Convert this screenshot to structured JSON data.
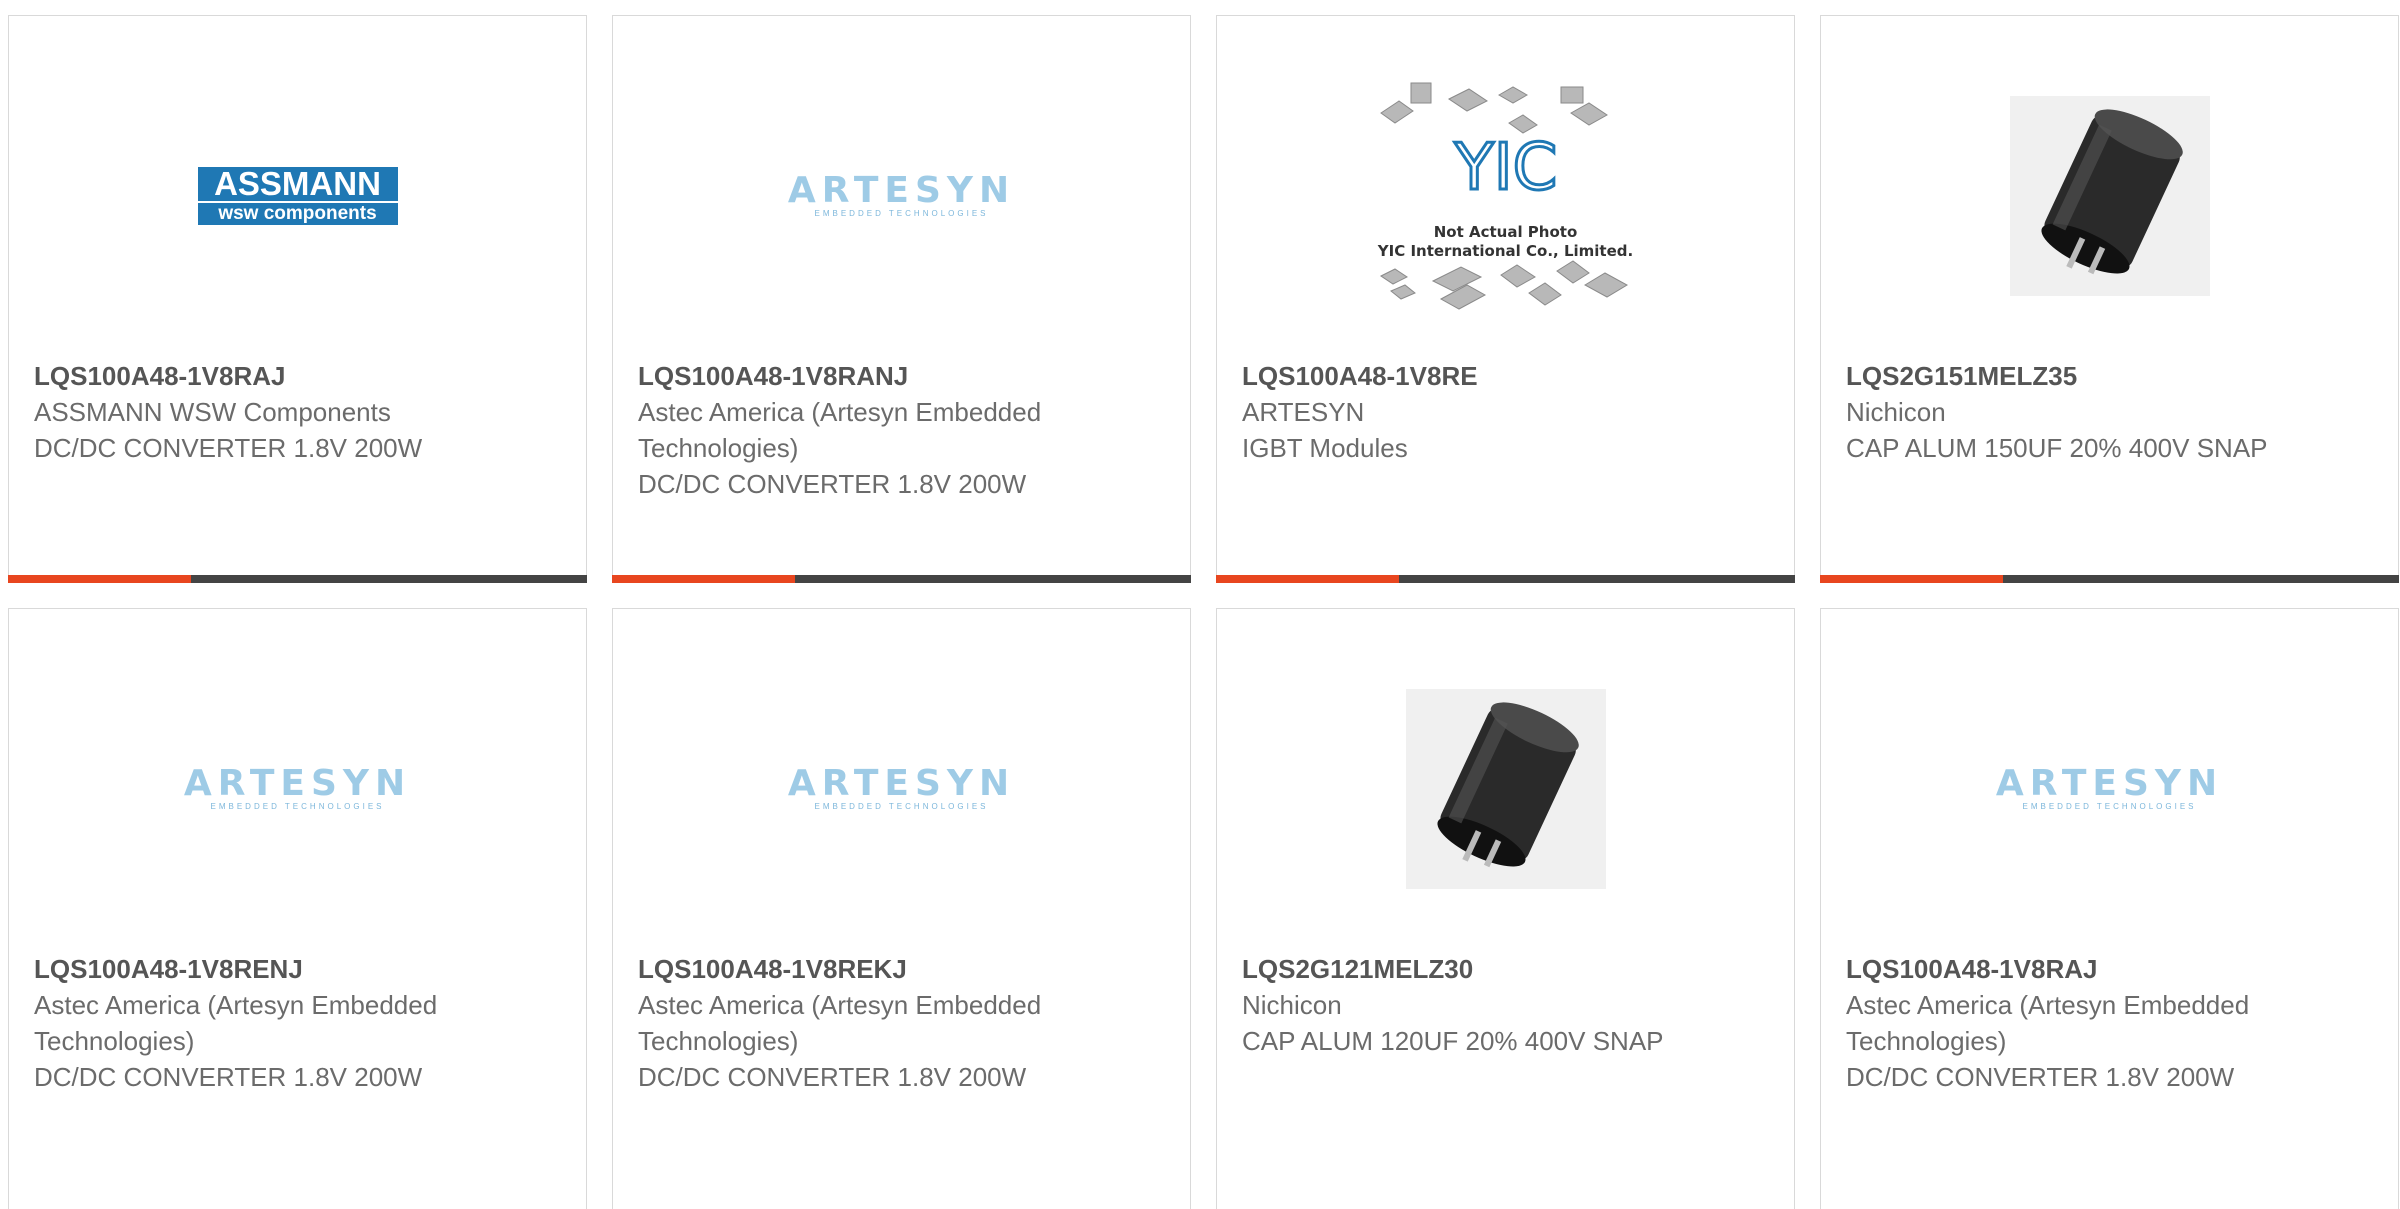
{
  "cards": [
    {
      "part_number": "LQS100A48-1V8RAJ",
      "manufacturer": "ASSMANN WSW Components",
      "description": "DC/DC CONVERTER 1.8V 200W",
      "image": "assmann-logo",
      "logo_text": "ASSMANN",
      "logo_subtext": "wsw components"
    },
    {
      "part_number": "LQS100A48-1V8RANJ",
      "manufacturer": "Astec America (Artesyn Embedded Technologies)",
      "description": "DC/DC CONVERTER 1.8V 200W",
      "image": "artesyn-logo",
      "logo_text": "ARTESYN",
      "logo_subtext": "EMBEDDED TECHNOLOGIES"
    },
    {
      "part_number": "LQS100A48-1V8RE",
      "manufacturer": "ARTESYN",
      "description": "IGBT Modules",
      "image": "yic-placeholder",
      "logo_text": "YIC",
      "caption_line1": "Not Actual Photo",
      "caption_line2": "YIC International Co., Limited."
    },
    {
      "part_number": "LQS2G151MELZ35",
      "manufacturer": "Nichicon",
      "description": "CAP ALUM 150UF 20% 400V SNAP",
      "image": "capacitor-photo"
    },
    {
      "part_number": "LQS100A48-1V8RENJ",
      "manufacturer": "Astec America (Artesyn Embedded Technologies)",
      "description": "DC/DC CONVERTER 1.8V 200W",
      "image": "artesyn-logo",
      "logo_text": "ARTESYN",
      "logo_subtext": "EMBEDDED TECHNOLOGIES"
    },
    {
      "part_number": "LQS100A48-1V8REKJ",
      "manufacturer": "Astec America (Artesyn Embedded Technologies)",
      "description": "DC/DC CONVERTER 1.8V 200W",
      "image": "artesyn-logo",
      "logo_text": "ARTESYN",
      "logo_subtext": "EMBEDDED TECHNOLOGIES"
    },
    {
      "part_number": "LQS2G121MELZ30",
      "manufacturer": "Nichicon",
      "description": "CAP ALUM 120UF 20% 400V SNAP",
      "image": "capacitor-photo"
    },
    {
      "part_number": "LQS100A48-1V8RAJ",
      "manufacturer": "Astec America (Artesyn Embedded Technologies)",
      "description": "DC/DC CONVERTER 1.8V 200W",
      "image": "artesyn-logo",
      "logo_text": "ARTESYN",
      "logo_subtext": "EMBEDDED TECHNOLOGIES"
    }
  ],
  "colors": {
    "accent": "#e8461f",
    "bar": "#444444",
    "border": "#d9d9d9",
    "text": "#6b6b6b",
    "part_text": "#555555",
    "assmann_blue": "#1f78b4",
    "artesyn_blue": "#9ecbe6"
  }
}
